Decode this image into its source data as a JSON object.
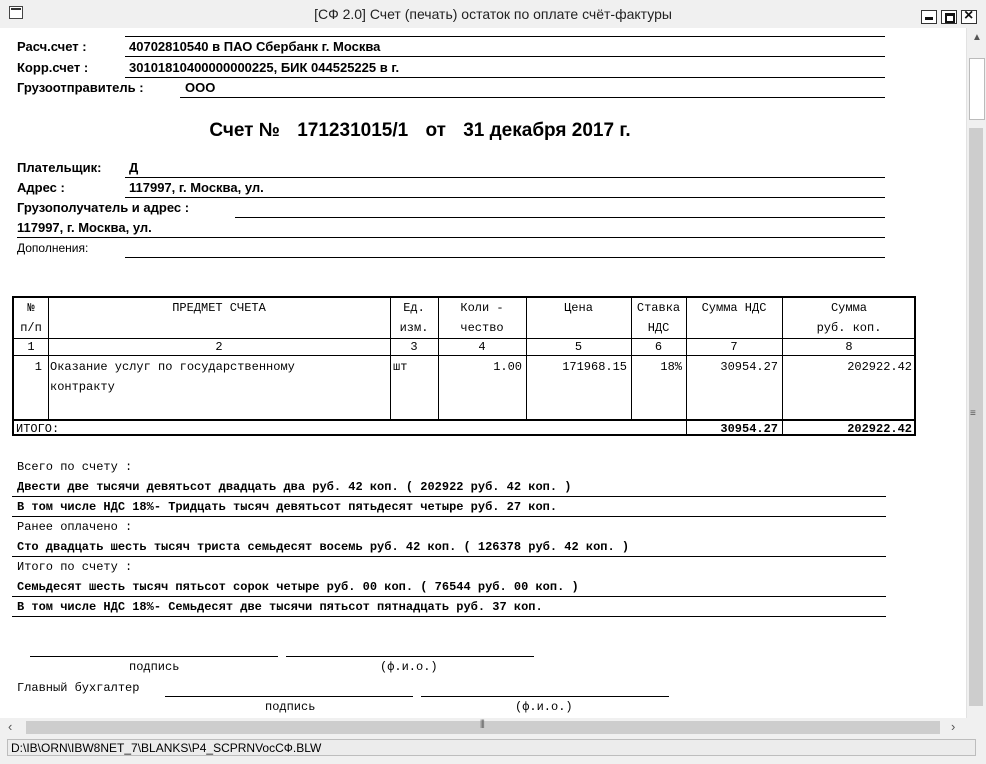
{
  "window": {
    "title": "[СФ 2.0] Счет (печать) остаток по оплате счёт-фактуры",
    "status_path": "D:\\IB\\ORN\\IBW8NET_7\\BLANKS\\P4_SCPRNVocСФ.BLW"
  },
  "bank": {
    "rs_label": "Расч.счет :",
    "rs_value": "40702810540             в ПАО Сбербанк г. Москва",
    "ks_label": "Корр.счет :",
    "ks_value": "30101810400000000225, БИК 044525225 в г.",
    "shipper_label": "Грузоотправитель :",
    "shipper_value": "ООО"
  },
  "invoice": {
    "prefix": "Счет  №",
    "number": "171231015/1",
    "from": "от",
    "date": "31 декабря 2017 г."
  },
  "payer": {
    "payer_label": "Плательщик:",
    "payer_value": "Д",
    "address_label": "Адрес     :",
    "address_value": "117997, г. Москва, ул.",
    "consignee_label": "Грузополучатель и адрес :",
    "consignee_address": "117997, г. Москва, ул.",
    "additions_label": "Дополнения:"
  },
  "table": {
    "headers": {
      "n1": "№",
      "n2": "п/п",
      "subject": "ПРЕДМЕТ СЧЕТА",
      "unit1": "Ед.",
      "unit2": "изм.",
      "qty1": "Коли -",
      "qty2": "чество",
      "price": "Цена",
      "rate1": "Ставка",
      "rate2": "НДС",
      "vat": "Сумма НДС",
      "sum1": "Сумма",
      "sum2": "руб.  коп."
    },
    "col_numbers": [
      "1",
      "2",
      "3",
      "4",
      "5",
      "6",
      "7",
      "8"
    ],
    "row": {
      "n": "1",
      "subject1": "Оказание услуг по государственному",
      "subject2": "контракту",
      "unit": "шт",
      "qty": "1.00",
      "price": "171968.15",
      "rate": "18%",
      "vat": "30954.27",
      "sum": "202922.42"
    },
    "total_label": "ИТОГО:",
    "total_vat": "30954.27",
    "total_sum": "202922.42"
  },
  "summary": {
    "total_label": "Всего по счету :",
    "total_words": "Двести две тысячи девятьсот двадцать два  руб. 42 коп.  ( 202922 руб. 42 коп. )",
    "total_vat": "В том числе НДС 18%- Тридцать тысяч девятьсот пятьдесят четыре  руб. 27 коп.",
    "paid_label": "Ранее оплачено :",
    "paid_words": "Сто двадцать шесть тысяч триста семьдесят восемь  руб. 42 коп.  ( 126378 руб. 42 коп. )",
    "due_label": "Итого по счету :",
    "due_words": "Семьдесят шесть тысяч пятьсот сорок четыре  руб. 00 коп.  ( 76544 руб. 00 коп. )",
    "due_vat": "В том числе НДС 18%- Семьдесят две тысячи пятьсот пятнадцать  руб. 37 коп."
  },
  "signatures": {
    "sign_label": "подпись",
    "name_label": "(ф.и.о.)",
    "accountant_label": "Главный бухгалтер",
    "sign_label2": "подпись",
    "name_label2": "(ф.и.о.)"
  }
}
